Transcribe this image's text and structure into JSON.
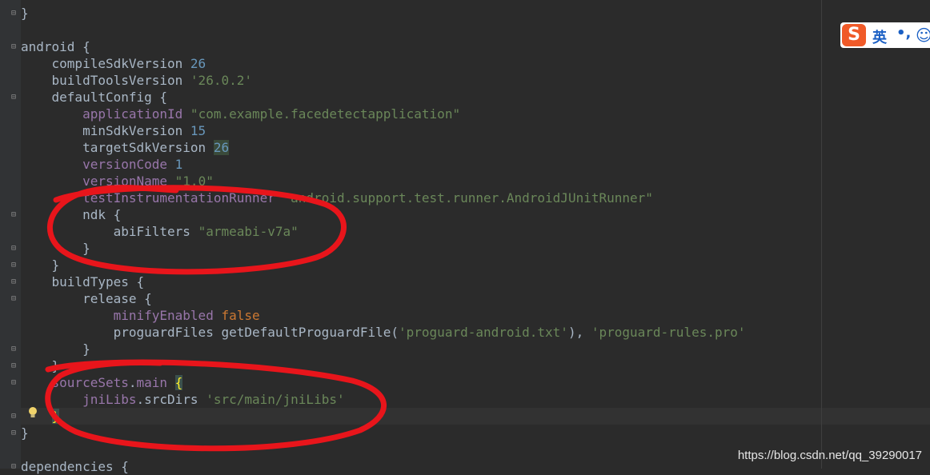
{
  "lines": [
    {
      "t": "}",
      "cls": "d"
    },
    {
      "t": "",
      "cls": "d"
    },
    {
      "t": "android {",
      "cls": "d"
    },
    {
      "t": "    compileSdkVersion ",
      "cls": "d",
      "extra": "26",
      "extraCls": "n"
    },
    {
      "t": "    buildToolsVersion ",
      "cls": "d",
      "extra": "'26.0.2'",
      "extraCls": "s"
    },
    {
      "t": "    defaultConfig {",
      "cls": "d"
    },
    {
      "t": "        ",
      "cls": "d",
      "kw": "applicationId",
      "extra": " \"com.example.facedetectapplication\"",
      "extraCls": "s"
    },
    {
      "t": "        minSdkVersion ",
      "cls": "d",
      "extra": "15",
      "extraCls": "n"
    },
    {
      "t": "        targetSdkVersion ",
      "cls": "d",
      "extra": "26",
      "extraCls": "hl"
    },
    {
      "t": "        ",
      "cls": "d",
      "kw": "versionCode",
      "extra": " 1",
      "extraCls": "n"
    },
    {
      "t": "        ",
      "cls": "d",
      "kw": "versionName",
      "extra": " \"1.0\"",
      "extraCls": "s"
    },
    {
      "t": "        ",
      "cls": "d",
      "kw": "testInstrumentationRunner",
      "extra": " \"android.support.test.runner.AndroidJUnitRunner\"",
      "extraCls": "s"
    },
    {
      "t": "        ndk {",
      "cls": "d"
    },
    {
      "t": "            abiFilters ",
      "cls": "d",
      "extra": "\"armeabi-v7a\"",
      "extraCls": "s"
    },
    {
      "t": "        }",
      "cls": "d"
    },
    {
      "t": "    }",
      "cls": "d"
    },
    {
      "t": "    buildTypes {",
      "cls": "d"
    },
    {
      "t": "        release {",
      "cls": "d"
    },
    {
      "t": "            ",
      "cls": "d",
      "kw": "minifyEnabled",
      "extra": " false",
      "extraCls": "k"
    },
    {
      "t": "            proguardFiles getDefaultProguardFile(",
      "cls": "d",
      "extra": "'proguard-android.txt'",
      "extraCls": "s",
      "tail": "), ",
      "tail2": "'proguard-rules.pro'"
    },
    {
      "t": "        }",
      "cls": "d"
    },
    {
      "t": "    }",
      "cls": "d"
    },
    {
      "t": "    ",
      "cls": "d",
      "kw": "sourceSets",
      "mid": ".",
      "kw2": "main",
      "extra": "{",
      "extraCls": "brace-hl"
    },
    {
      "t": "        ",
      "cls": "d",
      "kw": "jniLibs",
      "mid": ".srcDirs ",
      "extra": "'src/main/jniLibs'",
      "extraCls": "s"
    },
    {
      "t": "    ",
      "cls": "d",
      "extra": "}",
      "extraCls": "brace-hl"
    },
    {
      "t": "}",
      "cls": "d"
    },
    {
      "t": "",
      "cls": "d"
    },
    {
      "t": "dependencies {",
      "cls": "d"
    }
  ],
  "ime": {
    "logo": "S",
    "lang": "英",
    "punct": "•,",
    "emoji": "☺"
  },
  "watermark": "https://blog.csdn.net/qq_39290017",
  "colors": {
    "background": "#2b2b2b",
    "annotation": "#e8151b"
  }
}
